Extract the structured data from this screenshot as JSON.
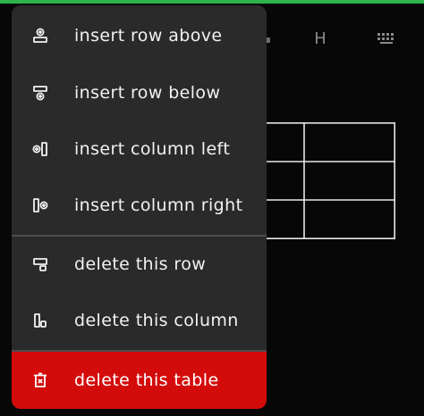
{
  "toolbar": {
    "heading_label": "H",
    "icons": [
      "bullet-icon",
      "heading-icon",
      "keyboard-icon"
    ]
  },
  "menu": {
    "items": [
      {
        "label": "insert row above",
        "icon": "insert-row-above-icon"
      },
      {
        "label": "insert row below",
        "icon": "insert-row-below-icon"
      },
      {
        "label": "insert column left",
        "icon": "insert-column-left-icon"
      },
      {
        "label": "insert column right",
        "icon": "insert-column-right-icon"
      },
      {
        "label": "delete this row",
        "icon": "delete-row-icon"
      },
      {
        "label": "delete this column",
        "icon": "delete-column-icon"
      },
      {
        "label": "delete this table",
        "icon": "delete-table-icon"
      }
    ]
  },
  "colors": {
    "accent": "#2fb24a",
    "menu_bg": "#2a2a2b",
    "danger": "#d40b0b",
    "text": "#f2f2f2"
  }
}
